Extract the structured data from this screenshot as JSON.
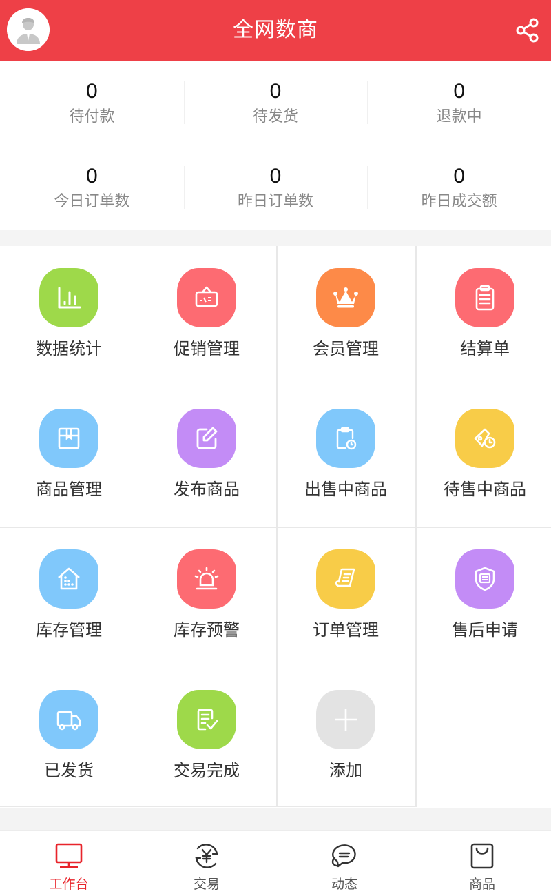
{
  "header": {
    "title": "全网数商",
    "avatar_icon": "user-avatar-icon",
    "share_icon": "share-icon",
    "background_color": "#ee4047"
  },
  "stats": {
    "row1": [
      {
        "value": "0",
        "label": "待付款"
      },
      {
        "value": "0",
        "label": "待发货"
      },
      {
        "value": "0",
        "label": "退款中"
      }
    ],
    "row2": [
      {
        "value": "0",
        "label": "今日订单数"
      },
      {
        "value": "0",
        "label": "昨日订单数"
      },
      {
        "value": "0",
        "label": "昨日成交额"
      }
    ]
  },
  "grid": {
    "items": [
      {
        "label": "数据统计",
        "icon": "bar-chart-icon",
        "color": "#9ed94a"
      },
      {
        "label": "促销管理",
        "icon": "sale-sign-icon",
        "color": "#fd6b72"
      },
      {
        "label": "会员管理",
        "icon": "crown-icon",
        "color": "#fd8a48"
      },
      {
        "label": "结算单",
        "icon": "clipboard-icon",
        "color": "#fd6b72"
      },
      {
        "label": "商品管理",
        "icon": "package-icon",
        "color": "#80c8fb"
      },
      {
        "label": "发布商品",
        "icon": "edit-icon",
        "color": "#c38cf6"
      },
      {
        "label": "出售中商品",
        "icon": "clipboard-clock-icon",
        "color": "#80c8fb"
      },
      {
        "label": "待售中商品",
        "icon": "tag-clock-icon",
        "color": "#f8cc48"
      },
      {
        "label": "库存管理",
        "icon": "warehouse-icon",
        "color": "#80c8fb"
      },
      {
        "label": "库存预警",
        "icon": "alarm-light-icon",
        "color": "#fd6b72"
      },
      {
        "label": "订单管理",
        "icon": "receipt-scroll-icon",
        "color": "#f8cc48"
      },
      {
        "label": "售后申请",
        "icon": "shield-badge-icon",
        "color": "#c38cf6"
      },
      {
        "label": "已发货",
        "icon": "delivery-truck-icon",
        "color": "#80c8fb"
      },
      {
        "label": "交易完成",
        "icon": "checklist-icon",
        "color": "#9ed94a"
      },
      {
        "label": "添加",
        "icon": "plus-icon",
        "color": "#e3e3e3"
      }
    ]
  },
  "tabbar": {
    "active_color": "#e8242b",
    "tabs": [
      {
        "label": "工作台",
        "icon": "monitor-icon",
        "active": true
      },
      {
        "label": "交易",
        "icon": "yuan-cycle-icon",
        "active": false
      },
      {
        "label": "动态",
        "icon": "chat-bubbles-icon",
        "active": false
      },
      {
        "label": "商品",
        "icon": "shopping-bag-icon",
        "active": false
      }
    ]
  }
}
